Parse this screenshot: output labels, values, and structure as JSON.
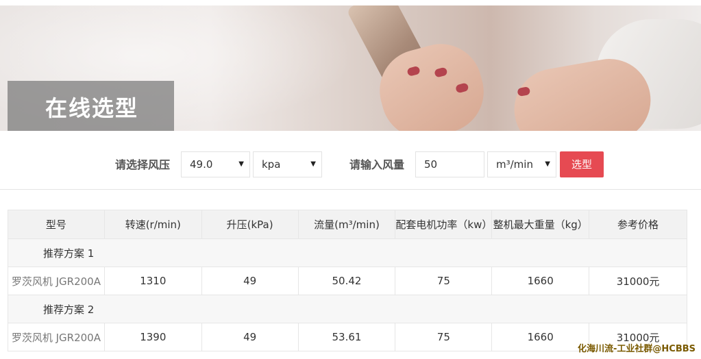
{
  "banner": {
    "title": "在线选型"
  },
  "form": {
    "pressure_label": "请选择风压",
    "pressure_value": "49.0",
    "pressure_unit": "kpa",
    "flow_label": "请输入风量",
    "flow_value": "50",
    "flow_unit": "m³/min",
    "submit_label": "选型"
  },
  "table": {
    "headers": [
      "型号",
      "转速(r/min)",
      "升压(kPa)",
      "流量(m³/min)",
      "配套电机功率（kw）",
      "整机最大重量（kg）",
      "参考价格"
    ],
    "groups": [
      {
        "name": "推荐方案 1",
        "row": [
          "罗茨风机 JGR200A",
          "1310",
          "49",
          "50.42",
          "75",
          "1660",
          "31000元"
        ]
      },
      {
        "name": "推荐方案 2",
        "row": [
          "罗茨风机 JGR200A",
          "1390",
          "49",
          "53.61",
          "75",
          "1660",
          "31000元"
        ]
      }
    ]
  },
  "watermark": "化海川流-工业社群@HCBBS"
}
